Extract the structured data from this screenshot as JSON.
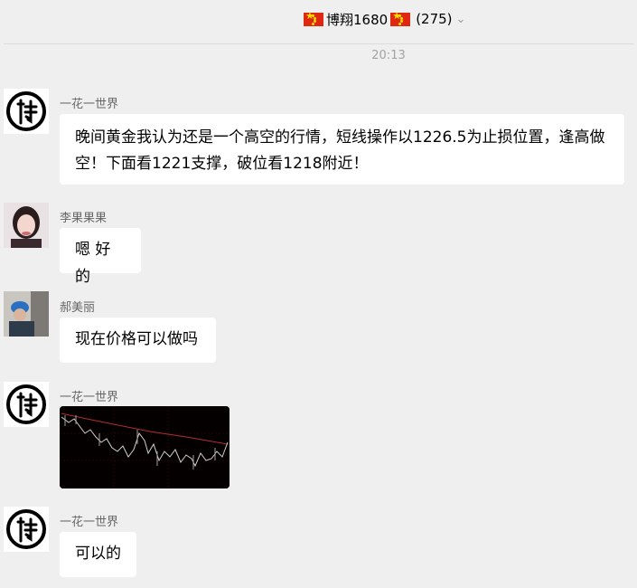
{
  "header": {
    "flag_icon": "china-flag-icon",
    "title": "博翔1680",
    "member_count": "(275)",
    "chevron": "⌄"
  },
  "timestamp": "20:13",
  "messages": [
    {
      "sender": "一花一世界",
      "avatar": "bo-logo-avatar",
      "text": "晚间黄金我认为还是一个高空的行情，短线操作以1226.5为止损位置，逢高做空！下面看1221支撑，破位看1218附近！"
    },
    {
      "sender": "李果果果",
      "avatar": "woman-photo-avatar",
      "text": "嗯 好的"
    },
    {
      "sender": "郝美丽",
      "avatar": "blue-cap-photo-avatar",
      "text": "现在价格可以做吗"
    },
    {
      "sender": "一花一世界",
      "avatar": "bo-logo-avatar",
      "image": "gold-price-chart-screenshot"
    },
    {
      "sender": "一花一世界",
      "avatar": "bo-logo-avatar",
      "text": "可以的"
    }
  ],
  "colors": {
    "background": "#efefef",
    "bubble": "#ffffff",
    "chart_background": "#050000"
  }
}
